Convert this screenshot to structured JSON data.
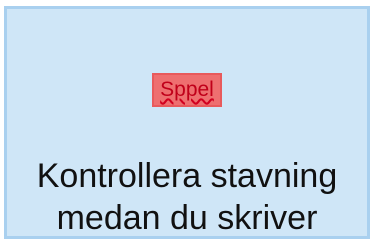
{
  "spelling_option": {
    "sample_word": "Sppel",
    "label_line1": "Kontrollera stavning",
    "label_line2": "medan du skriver"
  },
  "colors": {
    "tile_background": "#cfe6f7",
    "tile_border": "#a9d0ef",
    "error_highlight": "#ee6f70",
    "error_text": "#c0001a"
  }
}
